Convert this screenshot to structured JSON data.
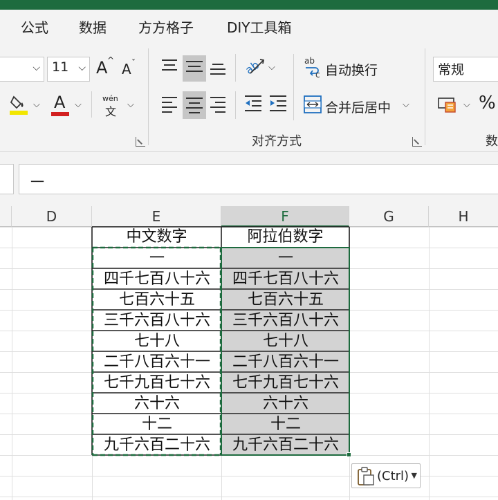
{
  "tabs": [
    "公式",
    "数据",
    "方方格子",
    "DIY工具箱"
  ],
  "font": {
    "name_value": "",
    "size_value": "11",
    "increase_label": "A",
    "decrease_label": "A",
    "phonetic_top": "wén",
    "phonetic_bottom": "文",
    "font_color_letter": "A"
  },
  "alignment": {
    "wrap_text": "自动换行",
    "merge_center": "合并后居中",
    "group_label": "对齐方式",
    "wrap_icon": "ab c"
  },
  "number": {
    "format_value": "常规",
    "percent": "%",
    "group_label_partial": "数"
  },
  "formula_bar": {
    "value": "一"
  },
  "columns": [
    "D",
    "E",
    "F",
    "G",
    "H"
  ],
  "table": {
    "headers": [
      "中文数字",
      "阿拉伯数字"
    ],
    "rows": [
      [
        "一",
        "一"
      ],
      [
        "四千七百八十六",
        "四千七百八十六"
      ],
      [
        "七百六十五",
        "七百六十五"
      ],
      [
        "三千六百八十六",
        "三千六百八十六"
      ],
      [
        "七十八",
        "七十八"
      ],
      [
        "二千八百六十一",
        "二千八百六十一"
      ],
      [
        "七千九百七十六",
        "七千九百七十六"
      ],
      [
        "六十六",
        "六十六"
      ],
      [
        "十二",
        "十二"
      ],
      [
        "九千六百二十六",
        "九千六百二十六"
      ]
    ]
  },
  "paste_options": {
    "label": "(Ctrl)"
  },
  "colors": {
    "accent": "#1d6b3e",
    "font_color": "#d21f1f",
    "highlight": "#f2e600",
    "selection": "#d3d3d3"
  }
}
